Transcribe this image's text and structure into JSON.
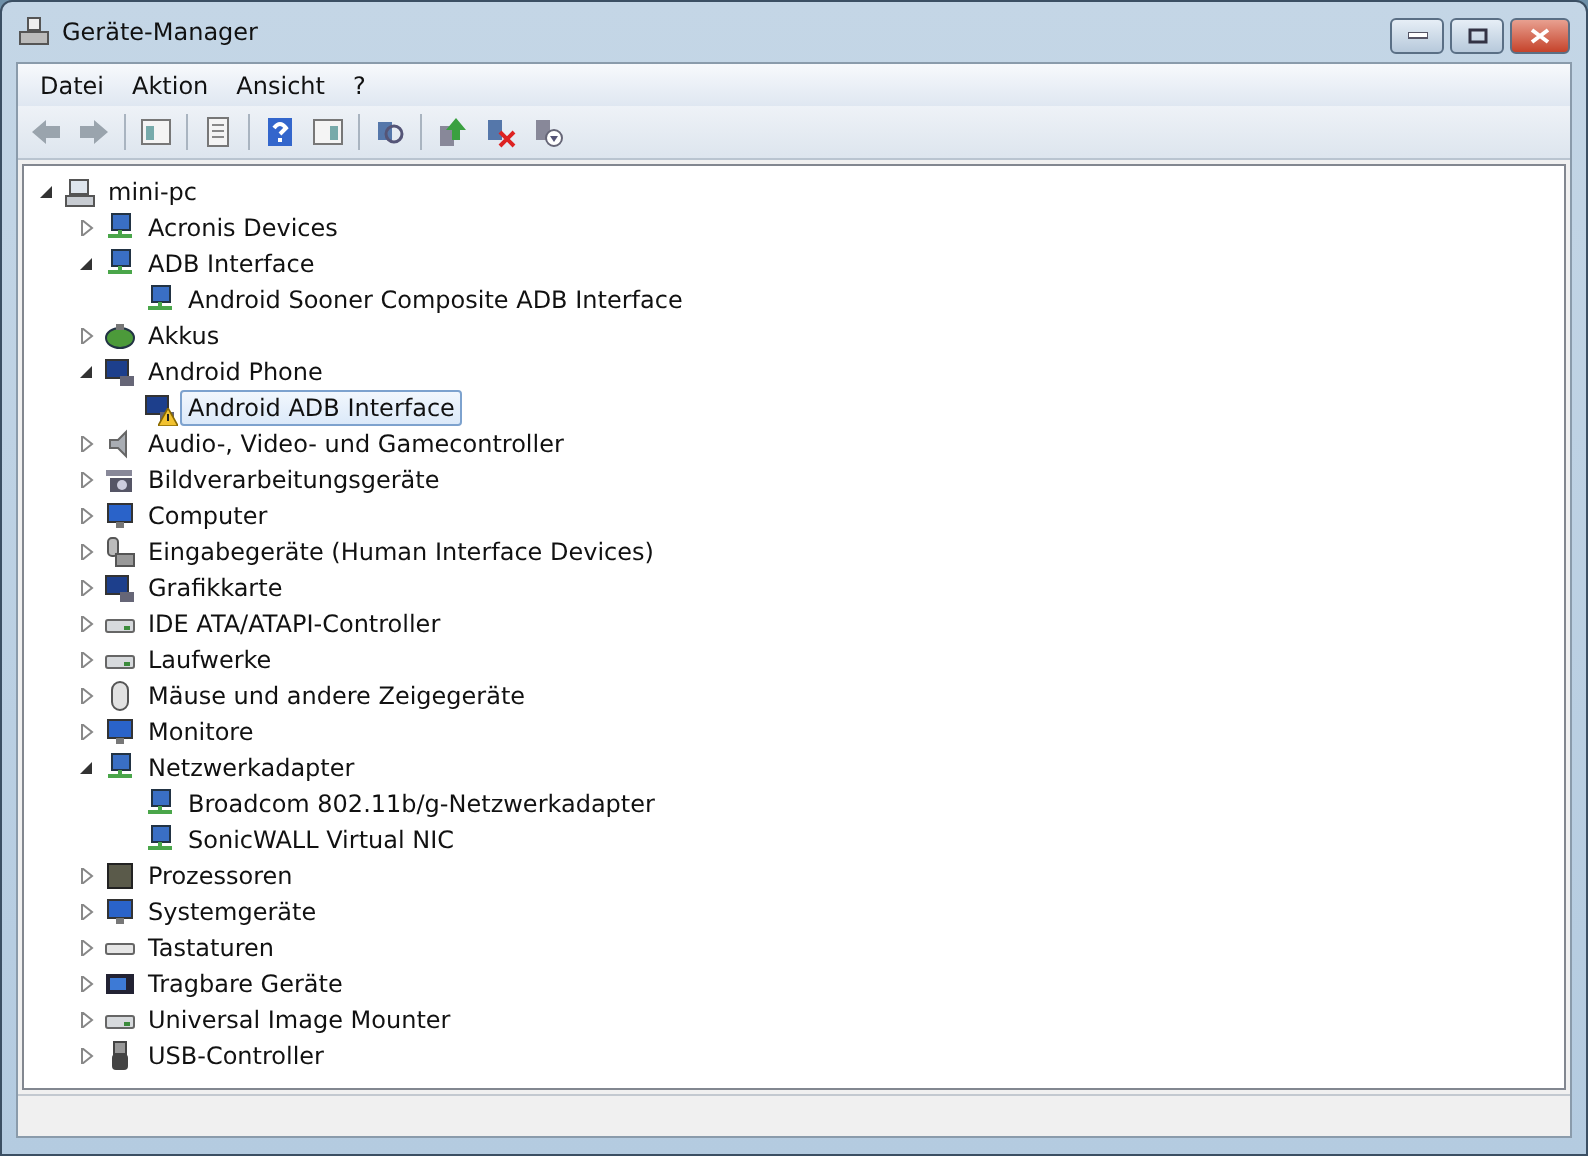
{
  "window": {
    "title": "Geräte-Manager"
  },
  "menu": [
    {
      "label": "Datei"
    },
    {
      "label": "Aktion"
    },
    {
      "label": "Ansicht"
    },
    {
      "label": "?"
    }
  ],
  "tree": [
    {
      "label": "mini-pc",
      "kind": "computer",
      "expanded": true,
      "selected": false,
      "warning": false,
      "children": [
        {
          "label": "Acronis Devices",
          "kind": "network",
          "expanded": false,
          "selected": false,
          "warning": false
        },
        {
          "label": "ADB Interface",
          "kind": "network",
          "expanded": true,
          "selected": false,
          "warning": false,
          "children": [
            {
              "label": "Android Sooner Composite ADB Interface",
              "kind": "network",
              "selected": false,
              "warning": false
            }
          ]
        },
        {
          "label": "Akkus",
          "kind": "battery",
          "expanded": false,
          "selected": false,
          "warning": false
        },
        {
          "label": "Android Phone",
          "kind": "display",
          "expanded": true,
          "selected": false,
          "warning": false,
          "children": [
            {
              "label": "Android ADB Interface",
              "kind": "display",
              "selected": true,
              "warning": true
            }
          ]
        },
        {
          "label": "Audio-, Video- und Gamecontroller",
          "kind": "audio",
          "expanded": false,
          "selected": false,
          "warning": false
        },
        {
          "label": "Bildverarbeitungsgeräte",
          "kind": "camera",
          "expanded": false,
          "selected": false,
          "warning": false
        },
        {
          "label": "Computer",
          "kind": "monitor",
          "expanded": false,
          "selected": false,
          "warning": false
        },
        {
          "label": "Eingabegeräte (Human Interface Devices)",
          "kind": "input",
          "expanded": false,
          "selected": false,
          "warning": false
        },
        {
          "label": "Grafikkarte",
          "kind": "display",
          "expanded": false,
          "selected": false,
          "warning": false
        },
        {
          "label": "IDE ATA/ATAPI-Controller",
          "kind": "drive",
          "expanded": false,
          "selected": false,
          "warning": false
        },
        {
          "label": "Laufwerke",
          "kind": "drive",
          "expanded": false,
          "selected": false,
          "warning": false
        },
        {
          "label": "Mäuse und andere Zeigegeräte",
          "kind": "mouse",
          "expanded": false,
          "selected": false,
          "warning": false
        },
        {
          "label": "Monitore",
          "kind": "monitor",
          "expanded": false,
          "selected": false,
          "warning": false
        },
        {
          "label": "Netzwerkadapter",
          "kind": "network",
          "expanded": true,
          "selected": false,
          "warning": false,
          "children": [
            {
              "label": "Broadcom 802.11b/g-Netzwerkadapter",
              "kind": "network",
              "selected": false,
              "warning": false
            },
            {
              "label": "SonicWALL Virtual NIC",
              "kind": "network",
              "selected": false,
              "warning": false
            }
          ]
        },
        {
          "label": "Prozessoren",
          "kind": "cpu",
          "expanded": false,
          "selected": false,
          "warning": false
        },
        {
          "label": "Systemgeräte",
          "kind": "monitor",
          "expanded": false,
          "selected": false,
          "warning": false
        },
        {
          "label": "Tastaturen",
          "kind": "keyboard",
          "expanded": false,
          "selected": false,
          "warning": false
        },
        {
          "label": "Tragbare Geräte",
          "kind": "portable",
          "expanded": false,
          "selected": false,
          "warning": false
        },
        {
          "label": "Universal Image Mounter",
          "kind": "drive",
          "expanded": false,
          "selected": false,
          "warning": false
        },
        {
          "label": "USB-Controller",
          "kind": "usb",
          "expanded": false,
          "selected": false,
          "warning": false
        }
      ]
    }
  ]
}
